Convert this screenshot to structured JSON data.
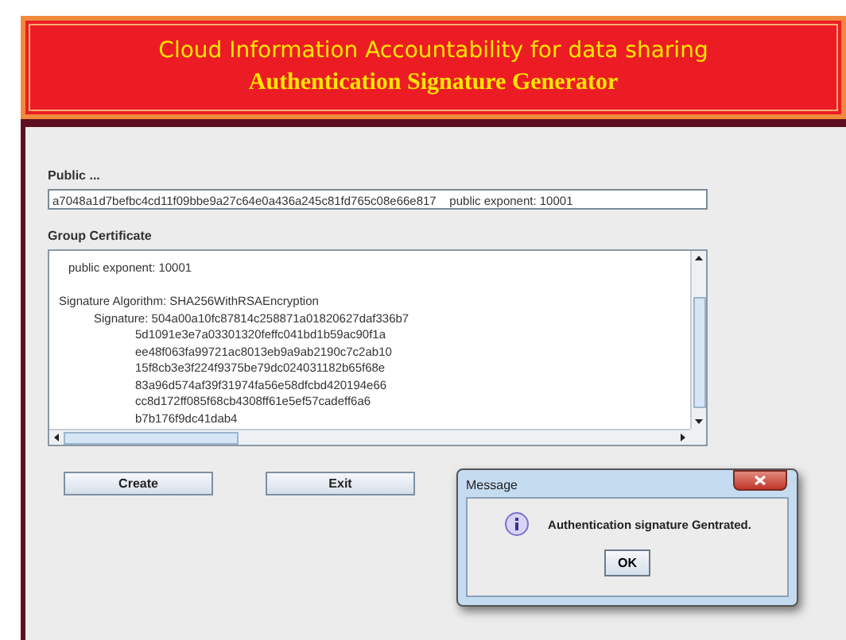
{
  "banner": {
    "title": "Cloud Information Accountability for data sharing",
    "subtitle": "Authentication Signature Generator"
  },
  "public_key": {
    "label": "Public ...",
    "value": "a7048a1d7befbc4cd11f09bbe9a27c64e0a436a245c81fd765c08e66e817    public exponent: 10001"
  },
  "certificate": {
    "label": "Group Certificate",
    "lines": [
      {
        "kind": "field",
        "text": "public exponent: 10001"
      },
      {
        "kind": "blank"
      },
      {
        "kind": "section",
        "text": "Signature Algorithm: SHA256WithRSAEncryption"
      },
      {
        "kind": "field2",
        "text": "Signature: 504a00a10fc87814c258871a01820627daf336b7"
      },
      {
        "kind": "cont",
        "text": "5d1091e3e7a03301320feffc041bd1b59ac90f1a"
      },
      {
        "kind": "cont",
        "text": "ee48f063fa99721ac8013eb9a9ab2190c7c2ab10"
      },
      {
        "kind": "cont",
        "text": "15f8cb3e3f224f9375be79dc024031182b65f68e"
      },
      {
        "kind": "cont",
        "text": "83a96d574af39f31974fa56e58dfcbd420194e66"
      },
      {
        "kind": "cont",
        "text": "cc8d172ff085f68cb4308ff61e5ef57cadeff6a6"
      },
      {
        "kind": "cont",
        "text": "b7b176f9dc41dab4"
      }
    ]
  },
  "buttons": [
    {
      "label": "Create"
    },
    {
      "label": "Exit"
    }
  ],
  "dialog": {
    "title": "Message",
    "message": "Authentication signature Gentrated.",
    "button": "OK"
  }
}
